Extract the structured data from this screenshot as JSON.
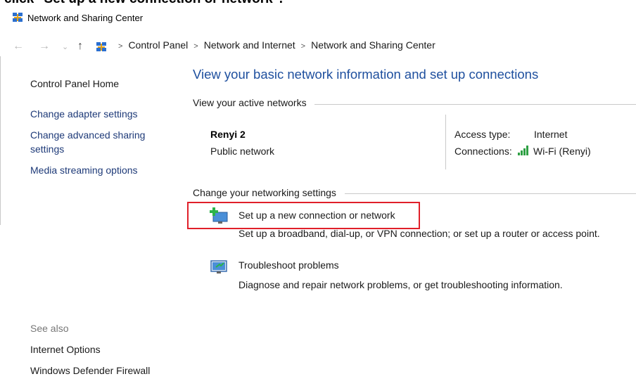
{
  "top_caption": "click \"Set up a new connection or network\".",
  "window": {
    "title": "Network and Sharing Center"
  },
  "breadcrumb": [
    "Control Panel",
    "Network and Internet",
    "Network and Sharing Center"
  ],
  "sidebar": {
    "home": "Control Panel Home",
    "links": [
      "Change adapter settings",
      "Change advanced sharing",
      "settings",
      "Media streaming options"
    ],
    "see_also_label": "See also",
    "see_also": [
      "Internet Options",
      "Windows Defender Firewall"
    ]
  },
  "main": {
    "heading": "View your basic network information and set up connections",
    "active_networks_label": "View your active networks",
    "network": {
      "name": "Renyi 2",
      "type": "Public network",
      "access_type_label": "Access type:",
      "access_type_value": "Internet",
      "connections_label": "Connections:",
      "connection_value": "Wi-Fi (Renyi)"
    },
    "change_settings_label": "Change your networking settings",
    "actions": [
      {
        "title": "Set up a new connection or network",
        "desc": "Set up a broadband, dial-up, or VPN connection; or set up a router or access point."
      },
      {
        "title": "Troubleshoot problems",
        "desc": "Diagnose and repair network problems, or get troubleshooting information."
      }
    ]
  },
  "colors": {
    "link": "#1d62c7",
    "heading": "#1e4f9e",
    "highlight": "#e0202a"
  }
}
